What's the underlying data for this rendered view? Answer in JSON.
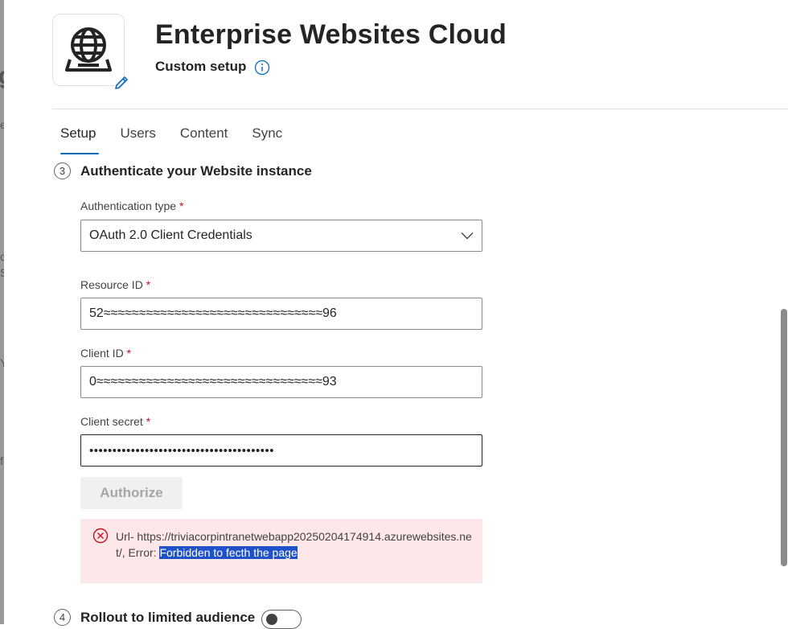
{
  "background_peek": {
    "items": [
      "g",
      "e",
      "o",
      "S",
      "Y",
      "fi"
    ]
  },
  "header": {
    "title": "Enterprise Websites Cloud",
    "subtitle": "Custom setup"
  },
  "tabs": [
    {
      "label": "Setup",
      "active": true
    },
    {
      "label": "Users",
      "active": false
    },
    {
      "label": "Content",
      "active": false
    },
    {
      "label": "Sync",
      "active": false
    }
  ],
  "step3": {
    "number": "3",
    "title": "Authenticate your Website instance"
  },
  "fields": {
    "auth_type": {
      "label": "Authentication type",
      "required": "*",
      "value": "OAuth 2.0 Client Credentials"
    },
    "resource_id": {
      "label": "Resource ID",
      "required": "*",
      "value": "52≈≈≈≈≈≈≈≈≈≈≈≈≈≈≈≈≈≈≈≈≈≈≈≈≈≈≈≈≈≈≈96"
    },
    "client_id": {
      "label": "Client ID",
      "required": "*",
      "value": "0≈≈≈≈≈≈≈≈≈≈≈≈≈≈≈≈≈≈≈≈≈≈≈≈≈≈≈≈≈≈≈≈93"
    },
    "client_secret": {
      "label": "Client secret",
      "required": "*",
      "value": "••••••••••••••••••••••••••••••••••••••••"
    }
  },
  "authorize_label": "Authorize",
  "error": {
    "prefix": "Url- https://triviacorpintranetwebapp20250204174914.azurewebsites.net/, Error: ",
    "highlighted": "Forbidden to fecth the page"
  },
  "step4": {
    "number": "4",
    "title": "Rollout to limited audience",
    "toggle_on": false
  },
  "colors": {
    "accent": "#0f6cbd",
    "error_bg": "#fde7e9",
    "error_icon": "#c50f1f",
    "selection": "#1f52c9"
  }
}
